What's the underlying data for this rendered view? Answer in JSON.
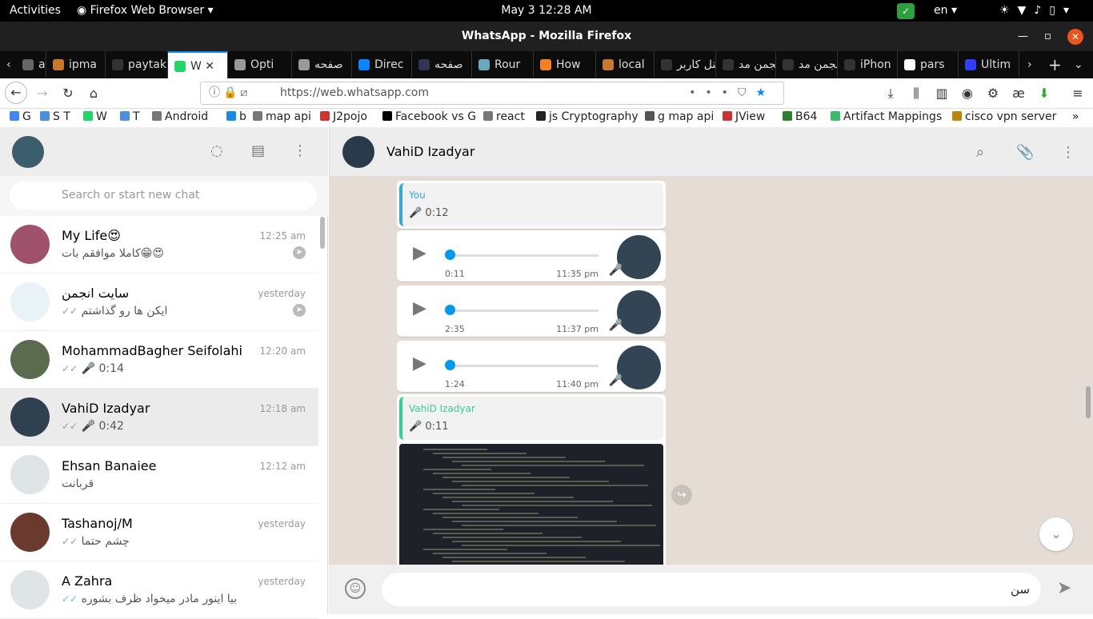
{
  "topbar": {
    "activities": "Activities",
    "app": "Firefox Web Browser",
    "clock": "May 3  12:28 AM",
    "lang": "en"
  },
  "window": {
    "title": "WhatsApp - Mozilla Firefox"
  },
  "tabs": [
    {
      "label": "an",
      "color": "#666"
    },
    {
      "label": "ipma",
      "color": "#c7792e"
    },
    {
      "label": "paytakht",
      "color": "#333"
    },
    {
      "label": "W",
      "color": "#25d366",
      "active": true
    },
    {
      "label": "Opti",
      "color": "#999"
    },
    {
      "label": "صفحه",
      "color": "#999"
    },
    {
      "label": "Direc",
      "color": "#0a84ff"
    },
    {
      "label": "صفحه",
      "color": "#335"
    },
    {
      "label": "Rour",
      "color": "#6ab"
    },
    {
      "label": "How",
      "color": "#f48024"
    },
    {
      "label": "local",
      "color": "#c7792e"
    },
    {
      "label": "پنل کاربر",
      "color": "#333"
    },
    {
      "label": "انجمن مد",
      "color": "#333"
    },
    {
      "label": "انجمن مد",
      "color": "#333"
    },
    {
      "label": "iPhon",
      "color": "#333"
    },
    {
      "label": "pars",
      "color": "#fff"
    },
    {
      "label": "Ultim",
      "color": "#2f3fff"
    }
  ],
  "nav": {
    "url": "https://web.whatsapp.com"
  },
  "bookmarks": [
    {
      "label": "G",
      "color": "#4285f4"
    },
    {
      "label": "S T",
      "color": "#4a90d9"
    },
    {
      "label": "W",
      "color": "#25d366"
    },
    {
      "label": "T",
      "color": "#4a90d9"
    },
    {
      "label": "Android",
      "color": "#777"
    },
    {
      "label": "b",
      "color": "#1e88e5"
    },
    {
      "label": "map api",
      "color": "#777"
    },
    {
      "label": "J2pojo",
      "color": "#c33"
    },
    {
      "label": "Facebook vs G",
      "color": "#000"
    },
    {
      "label": "react",
      "color": "#777"
    },
    {
      "label": "js Cryptography",
      "color": "#222"
    },
    {
      "label": "g map api",
      "color": "#555"
    },
    {
      "label": "JView",
      "color": "#c33"
    },
    {
      "label": "B64",
      "color": "#2e7d32"
    },
    {
      "label": "Artifact Mappings",
      "color": "#3dbb6d"
    },
    {
      "label": "cisco vpn server",
      "color": "#b8860b"
    }
  ],
  "search": {
    "placeholder": "Search or start new chat"
  },
  "chats": [
    {
      "name": "My Life😍",
      "time": "12:25 am",
      "preview": "کاملا موافقم بات😁😍",
      "avatar": "#a0526d",
      "pin": true
    },
    {
      "name": "سایت انجمن",
      "time": "yesterday",
      "preview": "ایکن ها رو گذاشتم",
      "avatar": "#e9f2f7",
      "ticks": "✓✓",
      "pin": true
    },
    {
      "name": "MohammadBagher Seifolahi",
      "time": "12:20 am",
      "preview": "🎤 0:14",
      "avatar": "#5a6b4f",
      "ticks": "✓✓"
    },
    {
      "name": "VahiD Izadyar",
      "time": "12:18 am",
      "preview": "🎤 0:42",
      "avatar": "#2f4050",
      "ticks": "✓✓",
      "selected": true
    },
    {
      "name": "Ehsan Banaiee",
      "time": "12:12 am",
      "preview": "قربانت",
      "avatar": "#dfe5e7"
    },
    {
      "name": "Tashanoj/M",
      "time": "yesterday",
      "preview": "چشم حتما",
      "avatar": "#6b3a2e",
      "ticks": "✓✓"
    },
    {
      "name": "A Zahra",
      "time": "yesterday",
      "preview": "بیا اینور مادر میخواد ظرف بشوره",
      "avatar": "#dfe5e7",
      "ticks": "✓✓",
      "blue": true
    }
  ],
  "conversation": {
    "name": "VahiD Izadyar",
    "quote1": {
      "who": "You",
      "dur": "0:12",
      "color": "#35a8d6"
    },
    "voices": [
      {
        "dur": "0:11",
        "time": "11:35 pm"
      },
      {
        "dur": "2:35",
        "time": "11:37 pm"
      },
      {
        "dur": "1:24",
        "time": "11:40 pm"
      }
    ],
    "quote2": {
      "who": "VahiD Izadyar",
      "dur": "0:11",
      "color": "#35cd96"
    },
    "composer_text": "سن"
  }
}
